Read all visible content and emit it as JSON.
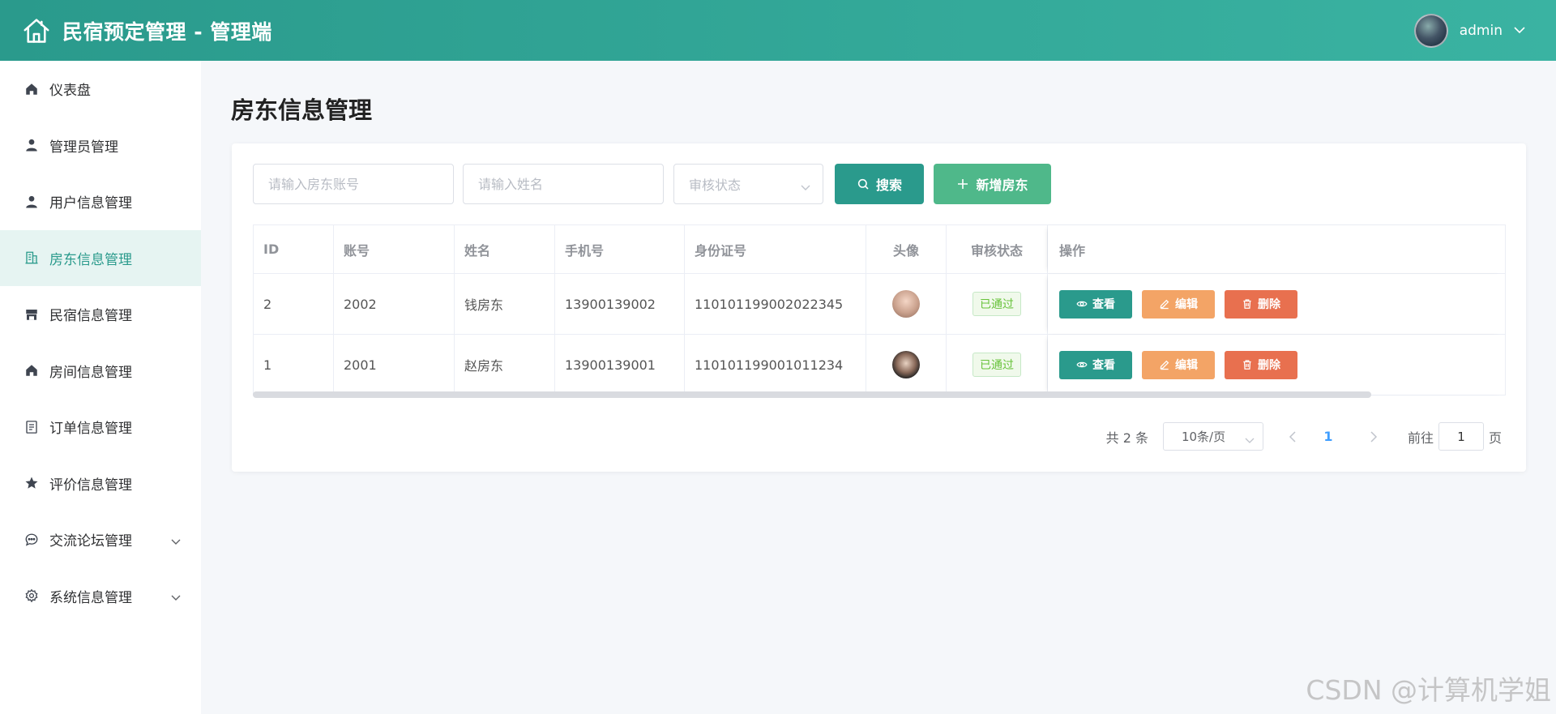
{
  "header": {
    "title": "民宿预定管理 - 管理端",
    "user": "admin"
  },
  "sidebar": {
    "items": [
      {
        "label": "仪表盘",
        "icon": "home-icon",
        "active": false
      },
      {
        "label": "管理员管理",
        "icon": "user-icon",
        "active": false
      },
      {
        "label": "用户信息管理",
        "icon": "user-icon",
        "active": false
      },
      {
        "label": "房东信息管理",
        "icon": "building-icon",
        "active": true
      },
      {
        "label": "民宿信息管理",
        "icon": "shop-icon",
        "active": false
      },
      {
        "label": "房间信息管理",
        "icon": "home-icon",
        "active": false
      },
      {
        "label": "订单信息管理",
        "icon": "document-icon",
        "active": false
      },
      {
        "label": "评价信息管理",
        "icon": "star-icon",
        "active": false
      },
      {
        "label": "交流论坛管理",
        "icon": "chat-icon",
        "active": false,
        "expandable": true
      },
      {
        "label": "系统信息管理",
        "icon": "gear-icon",
        "active": false,
        "expandable": true
      }
    ]
  },
  "main": {
    "title": "房东信息管理",
    "filters": {
      "account_placeholder": "请输入房东账号",
      "name_placeholder": "请输入姓名",
      "status_placeholder": "审核状态",
      "search_label": "搜索",
      "add_label": "新增房东"
    },
    "table": {
      "headers": [
        "ID",
        "账号",
        "姓名",
        "手机号",
        "身份证号",
        "头像",
        "审核状态",
        "操作"
      ],
      "rows": [
        {
          "id": "2",
          "account": "2002",
          "name": "钱房东",
          "phone": "13900139002",
          "idcard": "110101199002022345",
          "status": "已通过"
        },
        {
          "id": "1",
          "account": "2001",
          "name": "赵房东",
          "phone": "13900139001",
          "idcard": "110101199001011234",
          "status": "已通过"
        }
      ],
      "actions": {
        "view": "查看",
        "edit": "编辑",
        "delete": "删除"
      }
    },
    "pagination": {
      "total": "共 2 条",
      "page_size": "10条/页",
      "current": "1",
      "goto_label": "前往",
      "goto_value": "1",
      "page_suffix": "页"
    }
  },
  "watermark": "CSDN @计算机学姐",
  "colors": {
    "primary": "#2a9a8c",
    "add": "#4fb88a",
    "edit": "#f3a466",
    "delete": "#e8704f"
  }
}
